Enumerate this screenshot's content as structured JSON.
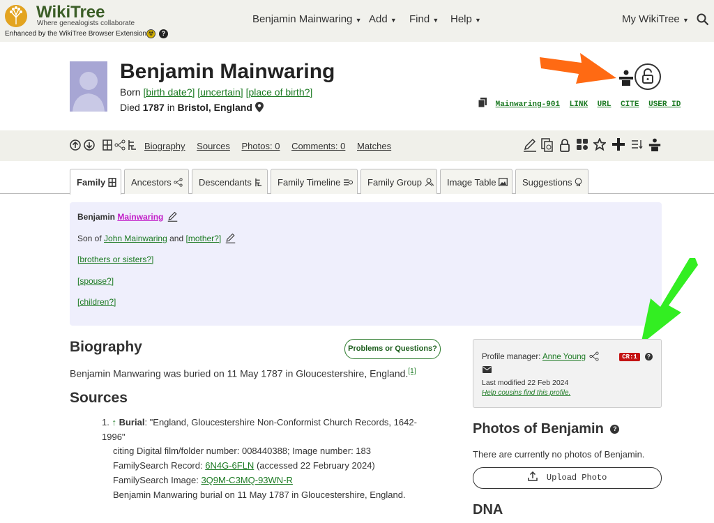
{
  "header": {
    "logo_name": "WikiTree",
    "logo_tagline": "Where genealogists collaborate",
    "extension_note": "Enhanced by the WikiTree Browser Extension",
    "nav": [
      "Benjamin Mainwaring",
      "Add",
      "Find",
      "Help"
    ],
    "my_wikitree": "My WikiTree"
  },
  "profile": {
    "name": "Benjamin Mainwaring",
    "born_label": "Born",
    "birth_date_link": "[birth date?]",
    "uncertain_link": "[uncertain]",
    "birth_place_link": "[place of birth?]",
    "died_label": "Died",
    "death_year": "1787",
    "in_word": "in",
    "death_place": "Bristol, England",
    "id_links": [
      "Mainwaring-901",
      "LINK",
      "URL",
      "CITE",
      "USER ID"
    ]
  },
  "toolbar": {
    "links": [
      "Biography",
      "Sources",
      "Photos: 0",
      "Comments: 0",
      "Matches"
    ]
  },
  "tabs": [
    "Family",
    "Ancestors",
    "Descendants",
    "Family Timeline",
    "Family Group",
    "Image Table",
    "Suggestions"
  ],
  "family": {
    "first_name": "Benjamin",
    "last_name": "Mainwaring",
    "son_of": "Son of",
    "father": "John Mainwaring",
    "and": "and",
    "mother": "[mother?]",
    "siblings": "[brothers or sisters?]",
    "spouse": "[spouse?]",
    "children": "[children?]"
  },
  "biography": {
    "heading": "Biography",
    "problems_button": "Problems or Questions?",
    "text": "Benjamin Manwaring was buried on 11 May 1787 in Gloucestershire, England.",
    "footnote": "[1]"
  },
  "sources": {
    "heading": "Sources",
    "number": "1.",
    "arrow": "↑",
    "label": "Burial",
    "title": ": \"England, Gloucestershire Non-Conformist Church Records, 1642-1996\"",
    "citing": "citing Digital film/folder number: 008440388; Image number: 183",
    "fs_record_label": "FamilySearch Record:",
    "fs_record_link": "6N4G-6FLN",
    "fs_record_accessed": "(accessed 22 February 2024)",
    "fs_image_label": "FamilySearch Image:",
    "fs_image_link": "3Q9M-C3MQ-93WN-R",
    "burial_note": "Benjamin Manwaring burial on 11 May 1787 in Gloucestershire, England."
  },
  "manager": {
    "label": "Profile manager:",
    "name": "Anne Young",
    "badge": "CR:1",
    "last_modified": "Last modified 22 Feb 2024",
    "help_link": "Help cousins find this profile."
  },
  "photos": {
    "heading": "Photos of Benjamin",
    "empty_text": "There are currently no photos of Benjamin.",
    "upload_button": "Upload Photo"
  },
  "dna": {
    "heading": "DNA"
  },
  "colors": {
    "link": "#1c7a23",
    "pink": "#c21fc8",
    "orange_arrow": "#ff6a13",
    "green_arrow": "#33ee22",
    "badge": "#c41414"
  },
  "annotations": [
    "orange-arrow",
    "green-arrow"
  ]
}
